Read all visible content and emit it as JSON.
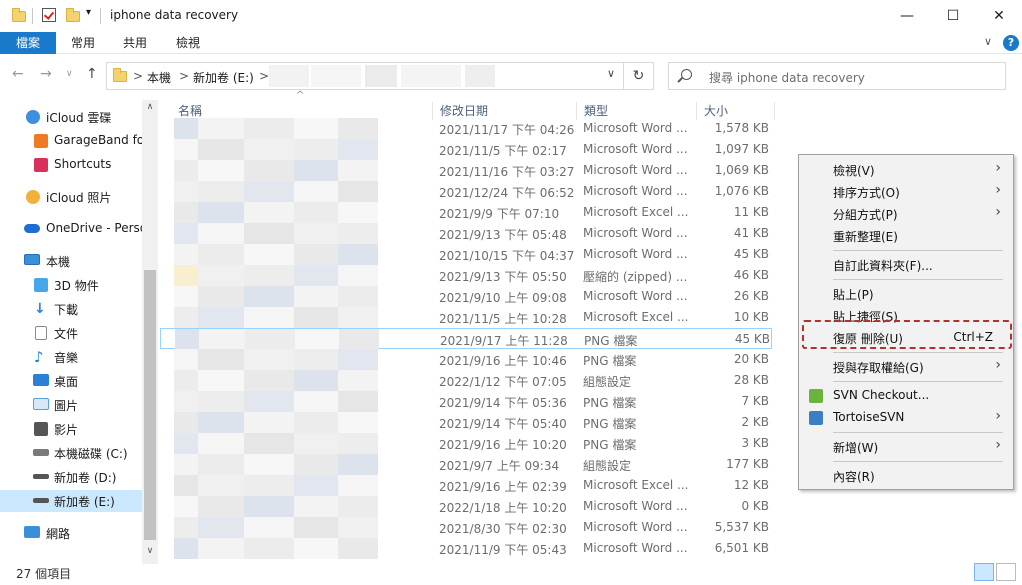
{
  "window": {
    "title": "iphone data recovery",
    "minimize_glyph": "—",
    "maximize_glyph": "☐",
    "close_glyph": "✕"
  },
  "ribbon": {
    "tabs": [
      {
        "label": "檔案",
        "active": true
      },
      {
        "label": "常用",
        "active": false
      },
      {
        "label": "共用",
        "active": false
      },
      {
        "label": "檢視",
        "active": false
      }
    ],
    "expand_glyph": "∨",
    "help_glyph": "?"
  },
  "nav": {
    "back_glyph": "←",
    "forward_glyph": "→",
    "recent_glyph": "∨",
    "up_glyph": "↑"
  },
  "address": {
    "crumbs": [
      "本機",
      "新加卷 (E:)"
    ],
    "separator": ">",
    "dropdown_glyph": "∨",
    "refresh_glyph": "↻"
  },
  "search": {
    "placeholder": "搜尋 iphone data recovery"
  },
  "sidebar": {
    "items": [
      {
        "label": "iCloud 雲碟",
        "icon": "icloud-drive-icon",
        "color": "#3d8fe0"
      },
      {
        "label": "GarageBand fo",
        "icon": "garageband-icon",
        "color": "#f07a24"
      },
      {
        "label": "Shortcuts",
        "icon": "shortcuts-icon",
        "color": "#d9305b"
      },
      {
        "label": "iCloud 照片",
        "icon": "icloud-photos-icon",
        "color": "#f2b13b"
      },
      {
        "label": "OneDrive - Perso",
        "icon": "onedrive-icon",
        "color": "#1c6fd1"
      },
      {
        "label": "本機",
        "icon": "this-pc-icon",
        "color": "#3b8fd9"
      },
      {
        "label": "3D 物件",
        "icon": "3d-objects-icon",
        "color": "#45a7e8"
      },
      {
        "label": "下載",
        "icon": "downloads-icon",
        "color": "#2b7fd4"
      },
      {
        "label": "文件",
        "icon": "documents-icon",
        "color": "#8a8a8a"
      },
      {
        "label": "音樂",
        "icon": "music-icon",
        "color": "#2b7fd4"
      },
      {
        "label": "桌面",
        "icon": "desktop-icon",
        "color": "#2b7fd4"
      },
      {
        "label": "圖片",
        "icon": "pictures-icon",
        "color": "#5a9fd6"
      },
      {
        "label": "影片",
        "icon": "videos-icon",
        "color": "#555555"
      },
      {
        "label": "本機磁碟 (C:)",
        "icon": "local-disk-icon",
        "color": "#7a7a7a"
      },
      {
        "label": "新加卷 (D:)",
        "icon": "drive-d-icon",
        "color": "#555555"
      },
      {
        "label": "新加卷 (E:)",
        "icon": "drive-e-icon",
        "color": "#555555",
        "selected": true
      },
      {
        "label": "網路",
        "icon": "network-icon",
        "color": "#3b8fd9"
      }
    ],
    "scroll_up_glyph": "∧",
    "scroll_down_glyph": "∨"
  },
  "columns": {
    "name": "名稱",
    "date": "修改日期",
    "type": "類型",
    "size": "大小",
    "sort_glyph": "^"
  },
  "files": [
    {
      "date": "2021/11/17 下午 04:26",
      "type": "Microsoft Word ...",
      "size": "1,578 KB"
    },
    {
      "date": "2021/11/5 下午 02:17",
      "type": "Microsoft Word ...",
      "size": "1,097 KB"
    },
    {
      "date": "2021/11/16 下午 03:27",
      "type": "Microsoft Word ...",
      "size": "1,069 KB"
    },
    {
      "date": "2021/12/24 下午 06:52",
      "type": "Microsoft Word ...",
      "size": "1,076 KB"
    },
    {
      "date": "2021/9/9 下午 07:10",
      "type": "Microsoft Excel ...",
      "size": "11 KB"
    },
    {
      "date": "2021/9/13 下午 05:48",
      "type": "Microsoft Word ...",
      "size": "41 KB"
    },
    {
      "date": "2021/10/15 下午 04:37",
      "type": "Microsoft Word ...",
      "size": "45 KB"
    },
    {
      "date": "2021/9/13 下午 05:50",
      "type": "壓縮的 (zipped) ...",
      "size": "46 KB"
    },
    {
      "date": "2021/9/10 上午 09:08",
      "type": "Microsoft Word ...",
      "size": "26 KB"
    },
    {
      "date": "2021/11/5 上午 10:28",
      "type": "Microsoft Excel ...",
      "size": "10 KB"
    },
    {
      "date": "2021/9/17 上午 11:28",
      "type": "PNG 檔案",
      "size": "45 KB",
      "highlight": true
    },
    {
      "date": "2021/9/16 上午 10:46",
      "type": "PNG 檔案",
      "size": "20 KB"
    },
    {
      "date": "2022/1/12 下午 07:05",
      "type": "組態設定",
      "size": "28 KB"
    },
    {
      "date": "2021/9/14 下午 05:36",
      "type": "PNG 檔案",
      "size": "7 KB"
    },
    {
      "date": "2021/9/14 下午 05:40",
      "type": "PNG 檔案",
      "size": "2 KB"
    },
    {
      "date": "2021/9/16 上午 10:20",
      "type": "PNG 檔案",
      "size": "3 KB"
    },
    {
      "date": "2021/9/7 上午 09:34",
      "type": "組態設定",
      "size": "177 KB"
    },
    {
      "date": "2021/9/16 上午 02:39",
      "type": "Microsoft Excel ...",
      "size": "12 KB"
    },
    {
      "date": "2022/1/18 上午 10:20",
      "type": "Microsoft Word ...",
      "size": "0 KB"
    },
    {
      "date": "2021/8/30 下午 02:30",
      "type": "Microsoft Word ...",
      "size": "5,537 KB"
    },
    {
      "date": "2021/11/9 下午 05:43",
      "type": "Microsoft Word ...",
      "size": "6,501 KB"
    }
  ],
  "context_menu": {
    "items": [
      {
        "label": "檢視(V)",
        "submenu": true
      },
      {
        "label": "排序方式(O)",
        "submenu": true
      },
      {
        "label": "分組方式(P)",
        "submenu": true
      },
      {
        "label": "重新整理(E)"
      },
      {
        "separator": true
      },
      {
        "label": "自訂此資料夾(F)..."
      },
      {
        "separator": true
      },
      {
        "label": "貼上(P)"
      },
      {
        "label": "貼上捷徑(S)"
      },
      {
        "label": "復原 刪除(U)",
        "shortcut": "Ctrl+Z",
        "highlighted_box": true
      },
      {
        "separator": true
      },
      {
        "label": "授與存取權給(G)",
        "submenu": true
      },
      {
        "separator": true
      },
      {
        "label": "SVN Checkout...",
        "icon": "svn-checkout-icon"
      },
      {
        "label": "TortoiseSVN",
        "icon": "tortoisesvn-icon",
        "submenu": true
      },
      {
        "separator": true
      },
      {
        "label": "新增(W)",
        "submenu": true
      },
      {
        "separator": true
      },
      {
        "label": "內容(R)"
      }
    ],
    "submenu_glyph": "›",
    "box_color": "#b4322c"
  },
  "status": {
    "item_count": "27 個項目"
  }
}
